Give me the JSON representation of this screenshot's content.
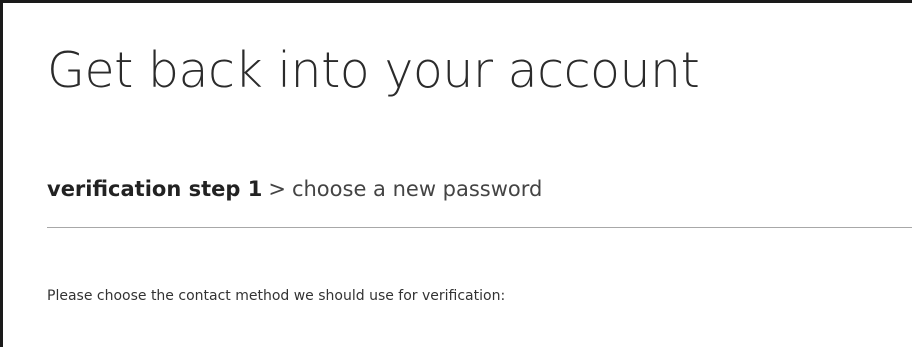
{
  "page": {
    "title": "Get back into your account"
  },
  "breadcrumb": {
    "current_step": "verification step 1",
    "separator": ">",
    "next_step": "choose a new password"
  },
  "main": {
    "instruction": "Please choose the contact method we should use for verification:"
  }
}
